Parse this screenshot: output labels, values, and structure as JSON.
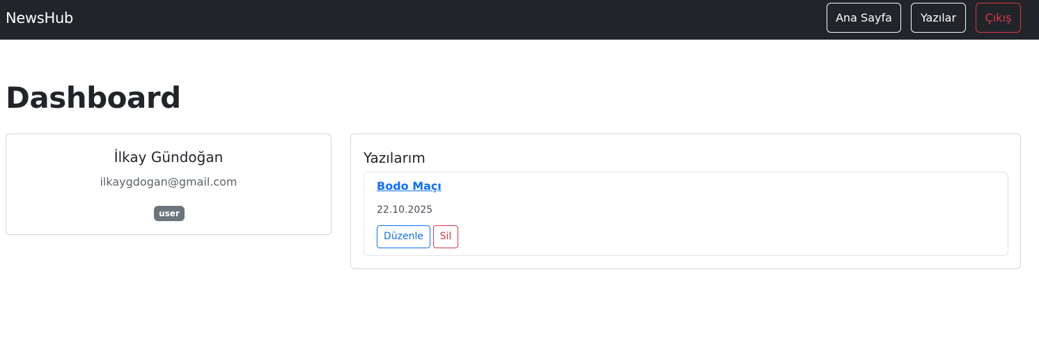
{
  "navbar": {
    "brand": "NewsHub",
    "home_label": "Ana Sayfa",
    "posts_label": "Yazılar",
    "logout_label": "Çıkış"
  },
  "page": {
    "title": "Dashboard"
  },
  "profile": {
    "name": "İlkay Gündoğan",
    "email": "ilkaygdogan@gmail.com",
    "role": "user"
  },
  "posts_section": {
    "title": "Yazılarım",
    "items": [
      {
        "title": "Bodo Maçı",
        "date": "22.10.2025",
        "edit_label": "Düzenle",
        "delete_label": "Sil"
      }
    ]
  },
  "colors": {
    "navbar_bg": "#212529",
    "primary": "#0d6efd",
    "danger": "#dc3545",
    "badge_bg": "#6c757d"
  }
}
